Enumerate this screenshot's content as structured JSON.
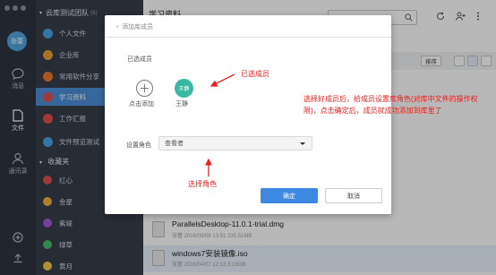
{
  "sidebar": {
    "avatar_text": "张蕾",
    "rail": [
      {
        "label": "消息"
      },
      {
        "label": "文件"
      },
      {
        "label": "通讯录"
      }
    ],
    "team_header": "云库测试团队",
    "team_count": "(6)",
    "items": [
      {
        "label": "个人文件",
        "color": "#4aa3df"
      },
      {
        "label": "企业库",
        "color": "#e8a03a"
      },
      {
        "label": "常用软件分享",
        "color": "#e9772e"
      },
      {
        "label": "学习资料",
        "color": "#e04f4f"
      },
      {
        "label": "工作汇报",
        "color": "#e05050"
      },
      {
        "label": "文件预览测试",
        "color": "#4aa3df"
      }
    ],
    "favorites_header": "收藏夹",
    "favorites": [
      {
        "label": "红心",
        "color": "#e04f4f"
      },
      {
        "label": "金星",
        "color": "#f0b23a"
      },
      {
        "label": "紫缇",
        "color": "#a45ad3"
      },
      {
        "label": "绿草",
        "color": "#4cb96a"
      },
      {
        "label": "黄月",
        "color": "#f2c94c"
      }
    ]
  },
  "main": {
    "title": "学习资料",
    "sort_label": "排序",
    "files": [
      {
        "name": "ParallelsDesktop-11.0.1-trial.dmg",
        "meta": "张蕾    2016/09/08 13:51    235.51MB"
      },
      {
        "name": "windows7安装镜像.iso",
        "meta": "张蕾    2016/04/07 12:13    3.19GB"
      }
    ]
  },
  "dialog": {
    "title": "添加库成员",
    "selected_label": "已选成员",
    "add_label": "点击添加",
    "member_avatar": "王静",
    "member_name": "王静",
    "role_label": "设置角色",
    "role_value": "查看者",
    "ok_label": "确定",
    "cancel_label": "取消"
  },
  "annotations": {
    "selected_members": "已选成员",
    "instruction": "选择好成员后，给成员设置库角色(对库中文件的操作权限)，点击确定后，成员就成功添加到库里了",
    "select_role": "选择角色"
  },
  "colors": {
    "accent": "#3d88e0",
    "annotation": "#e8201f",
    "member_avatar": "#3bb8a3"
  }
}
